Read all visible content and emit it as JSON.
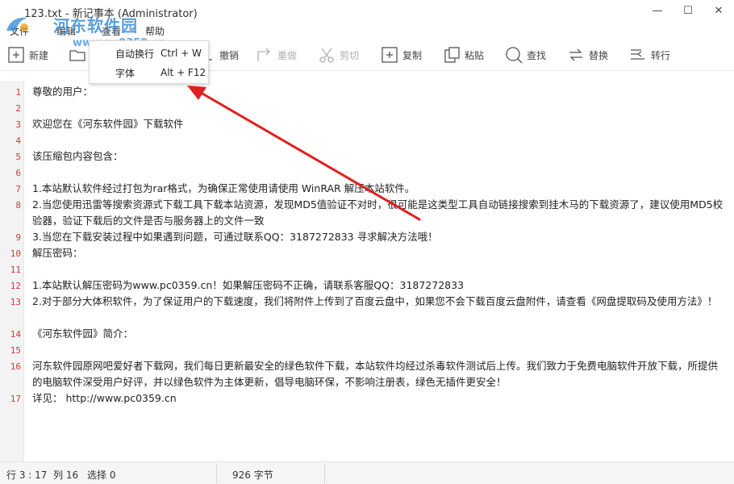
{
  "window": {
    "title": "123.txt - 新记事本 (Administrator)",
    "minimize_glyph": "—",
    "maximize_glyph": "☐",
    "close_glyph": "✕"
  },
  "watermark": {
    "text": "河东软件园",
    "url": "www.pc0359.cn"
  },
  "menu": {
    "file": "文件",
    "edit": "编辑",
    "view": "查看",
    "help": "帮助"
  },
  "toolbar": {
    "new": "新建",
    "undo": "撤销",
    "redo": "重做",
    "cut": "剪切",
    "copy": "复制",
    "paste": "粘贴",
    "find": "查找",
    "replace": "替换",
    "goto": "转行"
  },
  "dropdown": {
    "items": [
      {
        "label": "自动换行",
        "shortcut": "Ctrl + W"
      },
      {
        "label": "字体",
        "shortcut": "Alt + F12"
      }
    ]
  },
  "editor": {
    "lines": [
      {
        "num": "1",
        "text": "尊敬的用户："
      },
      {
        "num": "2",
        "text": ""
      },
      {
        "num": "3",
        "text": "欢迎您在《河东软件园》下载软件"
      },
      {
        "num": "4",
        "text": ""
      },
      {
        "num": "5",
        "text": "该压缩包内容包含："
      },
      {
        "num": "6",
        "text": ""
      },
      {
        "num": "7",
        "text": "1.本站默认软件经过打包为rar格式，为确保正常使用请使用 WinRAR 解压本站软件。"
      },
      {
        "num": "8",
        "text": "2.当您使用迅雷等搜索资源式下载工具下载本站资源，发现MD5值验证不对时，很可能是这类型工具自动链接搜索到挂木马的下载资源了，建议使用MD5校验器，验证下载后的文件是否与服务器上的文件一致"
      },
      {
        "num": "9",
        "text": "3.当您在下载安装过程中如果遇到问题，可通过联系QQ：3187272833 寻求解决方法哦！"
      },
      {
        "num": "10",
        "text": "解压密码："
      },
      {
        "num": "11",
        "text": ""
      },
      {
        "num": "12",
        "text": "1.本站默认解压密码为www.pc0359.cn！如果解压密码不正确，请联系客服QQ：3187272833"
      },
      {
        "num": "13",
        "text": "2.对于部分大体积软件，为了保证用户的下载速度，我们将附件上传到了百度云盘中，如果您不会下载百度云盘附件，请查看《网盘提取码及使用方法》！"
      },
      {
        "num": "14",
        "text": "《河东软件园》简介："
      },
      {
        "num": "15",
        "text": ""
      },
      {
        "num": "16",
        "text": "河东软件园原网吧爱好者下载网，我们每日更新最安全的绿色软件下载，本站软件均经过杀毒软件测试后上传。我们致力于免费电脑软件开放下载，所提供的电脑软件深受用户好评，并以绿色软件为主体更新，倡导电脑环保，不影响注册表，绿色无插件更安全！"
      },
      {
        "num": "17",
        "text": "详见： http://www.pc0359.cn"
      }
    ]
  },
  "status": {
    "row": "行 3 : 17",
    "col": "列 16",
    "selection": "选择 0",
    "bytes": "926 字节"
  },
  "colors": {
    "accent": "#3b8fd8",
    "line_numbers": "#d03a3a",
    "arrow": "#e02020"
  }
}
